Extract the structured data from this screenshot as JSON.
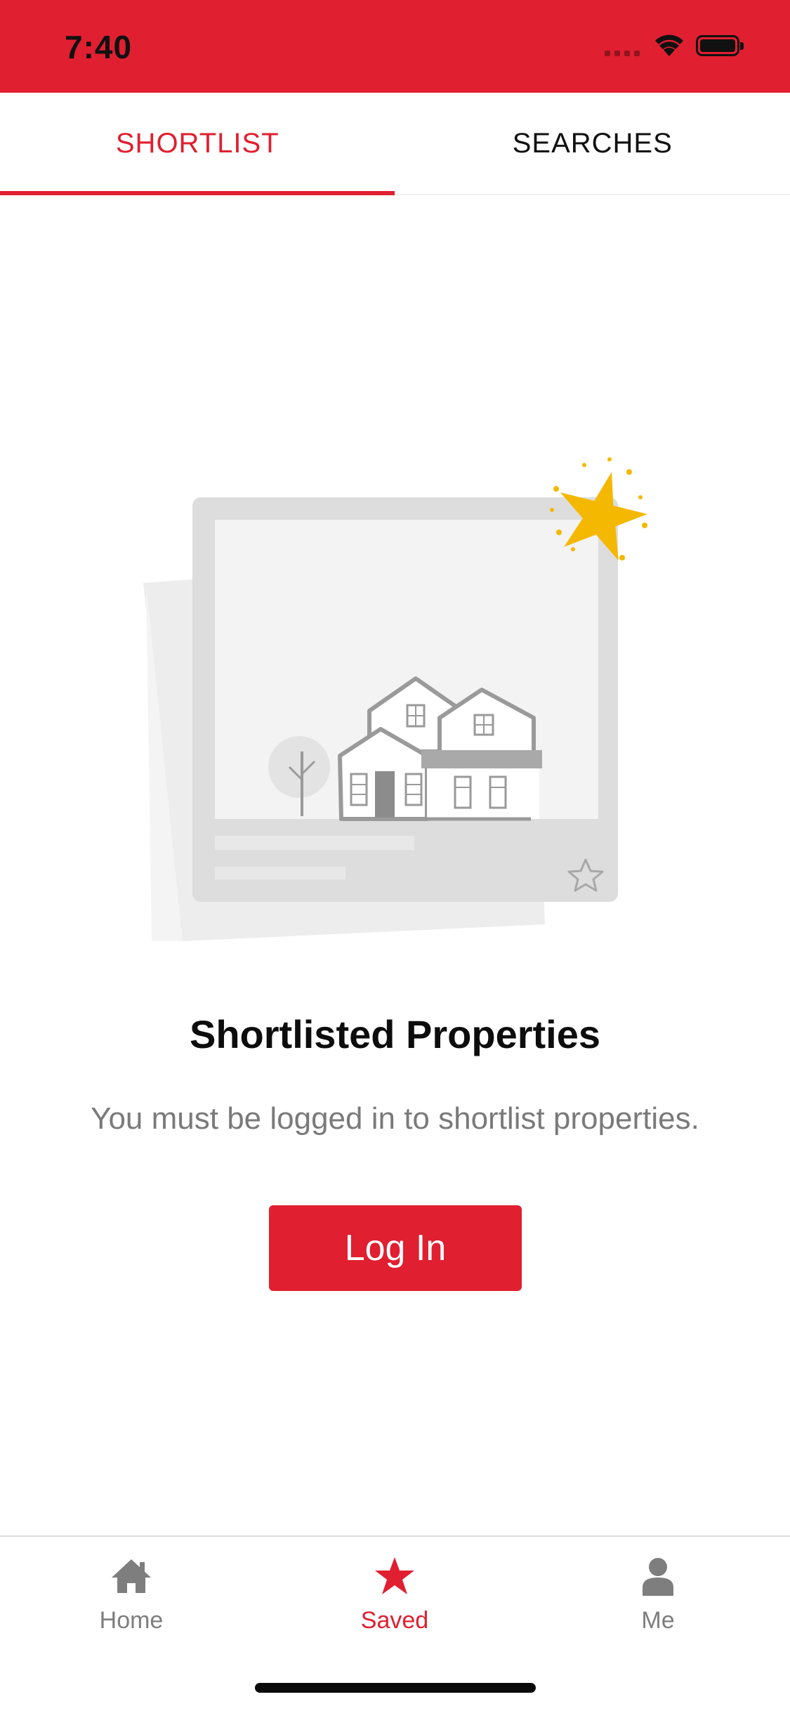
{
  "status_bar": {
    "time": "7:40",
    "background_color": "#E01F30"
  },
  "tabs": [
    {
      "label": "SHORTLIST",
      "active": true
    },
    {
      "label": "SEARCHES",
      "active": false
    }
  ],
  "empty_state": {
    "illustration": "house-card-with-star-illustration",
    "title": "Shortlisted Properties",
    "message": "You must be logged in to shortlist properties.",
    "button_label": "Log In"
  },
  "bottom_nav": [
    {
      "label": "Home",
      "icon": "home-icon",
      "active": false
    },
    {
      "label": "Saved",
      "icon": "star-icon",
      "active": true
    },
    {
      "label": "Me",
      "icon": "person-icon",
      "active": false
    }
  ],
  "colors": {
    "accent": "#E01F30",
    "inactive": "#7e7e7e",
    "star_gold": "#F5B800"
  }
}
